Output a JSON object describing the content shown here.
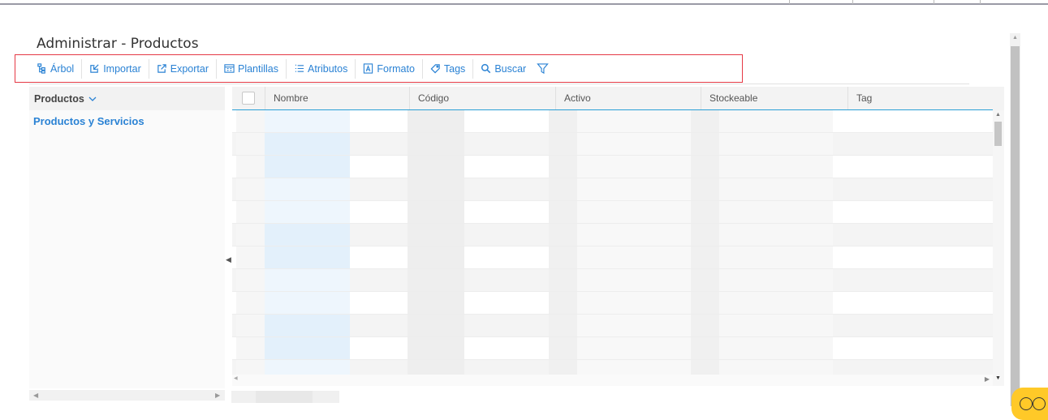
{
  "page": {
    "title": "Administrar - Productos"
  },
  "toolbar": {
    "buttons": [
      {
        "label": "Árbol",
        "icon": "tree-icon"
      },
      {
        "label": "Importar",
        "icon": "import-icon"
      },
      {
        "label": "Exportar",
        "icon": "export-icon"
      },
      {
        "label": "Plantillas",
        "icon": "templates-icon"
      },
      {
        "label": "Atributos",
        "icon": "list-icon"
      },
      {
        "label": "Formato",
        "icon": "format-icon"
      },
      {
        "label": "Tags",
        "icon": "tag-icon"
      },
      {
        "label": "Buscar",
        "icon": "search-icon"
      }
    ],
    "filter_icon": "filter-icon",
    "accent": "#2a82d4",
    "highlight_border": "#e53945"
  },
  "tree": {
    "header": "Productos",
    "items": [
      {
        "label": "Productos y Servicios"
      }
    ]
  },
  "grid": {
    "columns": [
      "Nombre",
      "Código",
      "Activo",
      "Stockeable",
      "Tag"
    ],
    "header_accent": "#2a9fd6"
  }
}
